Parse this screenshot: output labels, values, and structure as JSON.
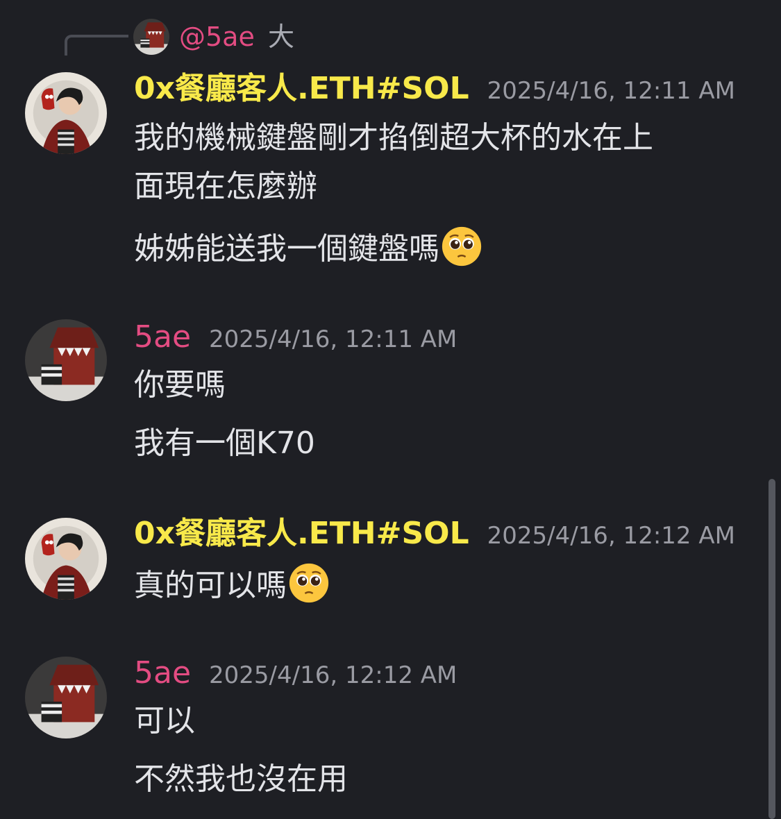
{
  "reply": {
    "username": "@5ae",
    "text": "大"
  },
  "messages": [
    {
      "username": "0x餐廳客人.ETH#SOL",
      "timestamp": "2025/4/16, 12:11 AM",
      "lines": [
        "我的機械鍵盤剛才掐倒超大杯的水在上",
        "面現在怎麼辦",
        "姊姊能送我一個鍵盤嗎"
      ],
      "emoji": "pleading-face"
    },
    {
      "username": "5ae",
      "timestamp": "2025/4/16, 12:11 AM",
      "lines": [
        "你要嗎",
        "我有一個K70"
      ]
    },
    {
      "username": "0x餐廳客人.ETH#SOL",
      "timestamp": "2025/4/16, 12:12 AM",
      "lines": [
        "真的可以嗎"
      ],
      "emoji": "pleading-face"
    },
    {
      "username": "5ae",
      "timestamp": "2025/4/16, 12:12 AM",
      "lines": [
        "可以",
        "不然我也沒在用"
      ]
    }
  ],
  "colors": {
    "background": "#1e1f24",
    "username_yellow": "#f8e94a",
    "username_pink": "#e34c82",
    "timestamp": "#9a9ba3",
    "text": "#e3e4e8"
  }
}
